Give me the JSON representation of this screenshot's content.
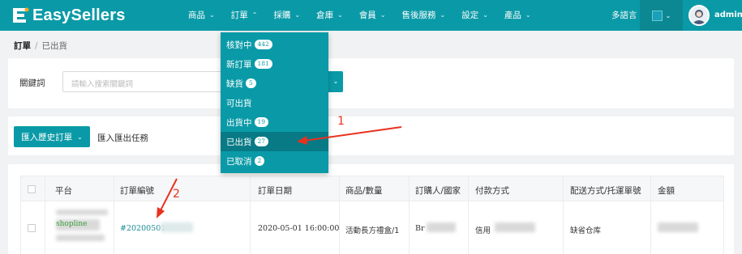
{
  "header": {
    "logo_text": "EasySellers",
    "nav": [
      {
        "label": "商品",
        "chevron": "down"
      },
      {
        "label": "訂單",
        "chevron": "up"
      },
      {
        "label": "採購",
        "chevron": "down"
      },
      {
        "label": "倉庫",
        "chevron": "down"
      },
      {
        "label": "會員",
        "chevron": "down"
      },
      {
        "label": "售後服務",
        "chevron": "down"
      },
      {
        "label": "設定",
        "chevron": "down"
      },
      {
        "label": "產品",
        "chevron": "down"
      }
    ],
    "language": "多語言",
    "theme_color": "#1aa0b8",
    "username": "admin",
    "bar_color": "#0a9aa7"
  },
  "breadcrumb": {
    "root": "訂單",
    "separator": "/",
    "current": "已出貨"
  },
  "search": {
    "label": "關鍵詞",
    "placeholder": "請輸入搜索關鍵詞"
  },
  "actions": {
    "import_label": "匯入歷史訂單",
    "export_task_label": "匯入匯出任務"
  },
  "table": {
    "columns": [
      "平台",
      "訂單編號",
      "訂單日期",
      "商品/數量",
      "訂購人/國家",
      "付款方式",
      "配送方式/托運單號",
      "金額"
    ],
    "rows": [
      {
        "platform": "shopline",
        "order_no": "#20200501",
        "order_date": "2020-05-01 16:00:00",
        "product_qty": "活動長方禮盒/1",
        "buyer_country": "Br",
        "payment": "信用",
        "shipping": "缺省仓库",
        "amount": ""
      }
    ]
  },
  "order_menu": {
    "items": [
      {
        "label": "核對中",
        "count": "442",
        "active": false
      },
      {
        "label": "新訂單",
        "count": "181",
        "active": false
      },
      {
        "label": "缺貨",
        "count": "5",
        "active": false
      },
      {
        "label": "可出貨",
        "count": "",
        "active": false
      },
      {
        "label": "出貨中",
        "count": "19",
        "active": false
      },
      {
        "label": "已出貨",
        "count": "27",
        "active": true
      },
      {
        "label": "已取消",
        "count": "2",
        "active": false
      }
    ]
  },
  "annotations": {
    "marker_1": "1",
    "marker_2": "2",
    "color": "#e8321e"
  }
}
